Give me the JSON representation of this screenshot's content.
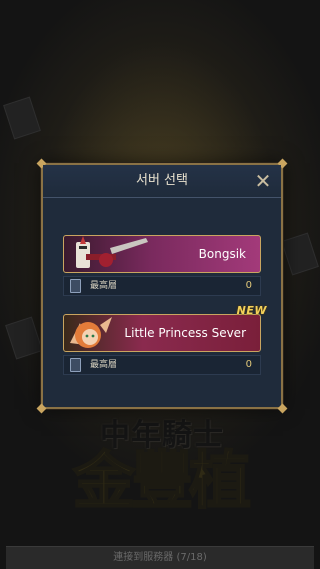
{
  "dialog": {
    "title": "서버 선택",
    "close_icon": "close-icon"
  },
  "servers": [
    {
      "name": "Bongsik",
      "is_new": false,
      "highest_floor_label": "最高層",
      "highest_floor_value": "0"
    },
    {
      "name": "Little Princess Sever",
      "is_new": true,
      "new_label": "NEW",
      "highest_floor_label": "最高層",
      "highest_floor_value": "0"
    }
  ],
  "background": {
    "logo_top": "中年騎士",
    "logo_main": "金豐植",
    "status_text": "連接到服務器 (7/18)"
  },
  "colors": {
    "frame_gold": "#8a7245",
    "panel_navy": "#1f2b3b",
    "value_gold": "#e0c77a",
    "new_badge": "#f3d15a"
  }
}
